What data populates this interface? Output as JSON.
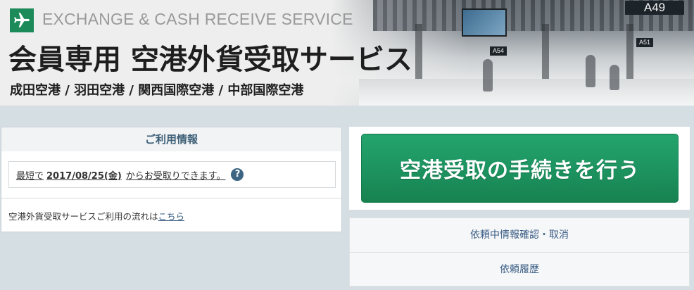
{
  "banner": {
    "en_title": "EXCHANGE & CASH RECEIVE SERVICE",
    "jp_title": "会員専用 空港外貨受取サービス",
    "airports": "成田空港 / 羽田空港 / 関西国際空港 / 中部国際空港",
    "logo_icon": "airplane-icon",
    "brand_color": "#1d8a5a",
    "gate_sign": "A49",
    "gate_small_1": "A51",
    "gate_small_2": "A54"
  },
  "info": {
    "heading": "ご利用情報",
    "earliest_prefix": "最短で",
    "earliest_date": "2017/08/25(金)",
    "earliest_suffix": "からお受取りできます。",
    "help_icon": "question-circle-icon",
    "help_glyph": "?",
    "flow_text": "空港外貨受取サービスご利用の流れは",
    "flow_link": "こちら"
  },
  "cta": {
    "label": "空港受取の手続きを行う",
    "color": "#1d9461"
  },
  "nav": {
    "items": [
      {
        "label": "依頼中情報確認・取消"
      },
      {
        "label": "依頼履歴"
      }
    ]
  }
}
